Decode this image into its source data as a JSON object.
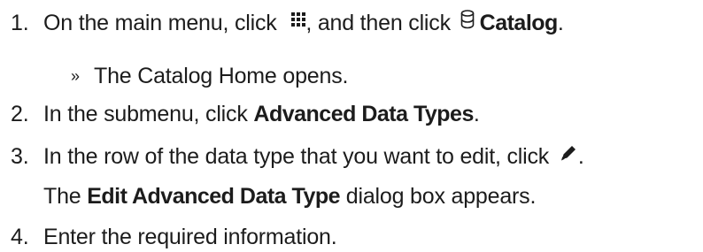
{
  "steps": [
    {
      "number": "1.",
      "text_before": "On the main menu, click",
      "icon_1": "grid-menu-icon",
      "text_middle": ", and then click",
      "icon_2": "database-icon",
      "bold": "Catalog",
      "text_after": ".",
      "result": {
        "bullet": "»",
        "text": "The Catalog Home opens."
      }
    },
    {
      "number": "2.",
      "text_before": "In the submenu, click",
      "bold": "Advanced Data Types",
      "text_after": "."
    },
    {
      "number": "3.",
      "text_before": "In the row of the data type that you want to edit, click",
      "icon": "pencil-icon",
      "text_after": ".",
      "note": {
        "text_before": "The",
        "bold": "Edit Advanced Data Type",
        "text_after": "dialog box appears."
      }
    },
    {
      "number": "4.",
      "text": "Enter the required information."
    }
  ],
  "colors": {
    "text": "#1c1c1c"
  }
}
